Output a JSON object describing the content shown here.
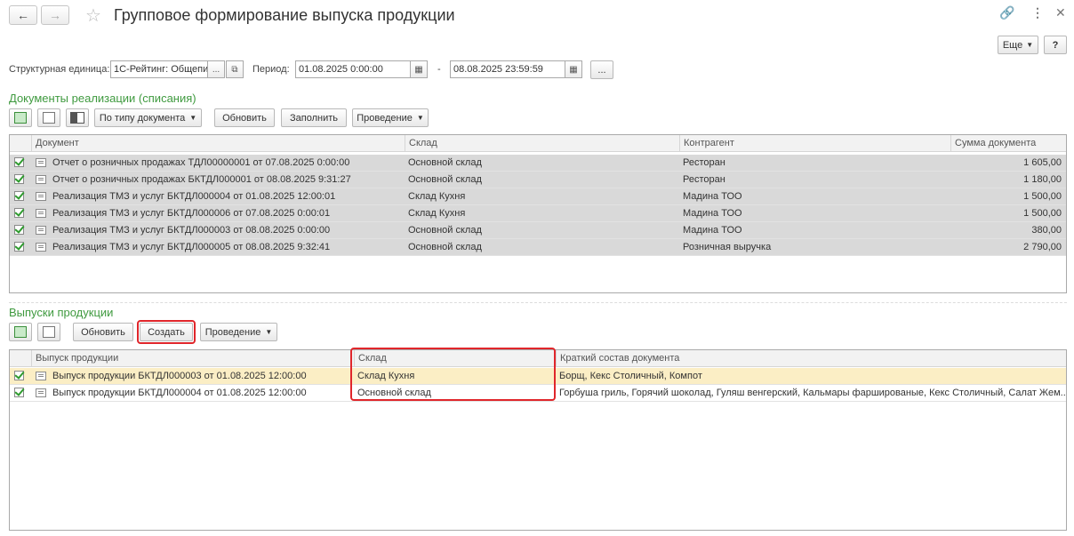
{
  "window": {
    "title": "Групповое формирование выпуска продукции",
    "more_label": "Еще",
    "help_label": "?"
  },
  "filters": {
    "unit_label": "Структурная единица:",
    "unit_value": "1С-Рейтинг: Общепи",
    "period_label": "Период:",
    "date_from": "01.08.2025  0:00:00",
    "date_to": "08.08.2025 23:59:59",
    "dash": "-",
    "dots": "..."
  },
  "sales": {
    "section_title": "Документы реализации (списания)",
    "toolbar": {
      "by_type_label": "По типу документа",
      "refresh_label": "Обновить",
      "fill_label": "Заполнить",
      "posting_label": "Проведение"
    },
    "columns": [
      "Документ",
      "Склад",
      "Контрагент",
      "Сумма документа"
    ],
    "rows": [
      {
        "doc": "Отчет о розничных продажах ТДЛ00000001 от 07.08.2025 0:00:00",
        "warehouse": "Основной склад",
        "partner": "Ресторан",
        "amount": "1 605,00"
      },
      {
        "doc": "Отчет о розничных продажах БКТДЛ000001 от 08.08.2025 9:31:27",
        "warehouse": "Основной склад",
        "partner": "Ресторан",
        "amount": "1 180,00"
      },
      {
        "doc": "Реализация ТМЗ и услуг БКТДЛ000004 от 01.08.2025 12:00:01",
        "warehouse": "Склад Кухня",
        "partner": "Мадина ТОО",
        "amount": "1 500,00"
      },
      {
        "doc": "Реализация ТМЗ и услуг БКТДЛ000006 от 07.08.2025 0:00:01",
        "warehouse": "Склад Кухня",
        "partner": "Мадина ТОО",
        "amount": "1 500,00"
      },
      {
        "doc": "Реализация ТМЗ и услуг БКТДЛ000003 от 08.08.2025 0:00:00",
        "warehouse": "Основной склад",
        "partner": "Мадина ТОО",
        "amount": "380,00"
      },
      {
        "doc": "Реализация ТМЗ и услуг БКТДЛ000005 от 08.08.2025 9:32:41",
        "warehouse": "Основной склад",
        "partner": "Розничная выручка",
        "amount": "2 790,00"
      }
    ]
  },
  "releases": {
    "section_title": "Выпуски продукции",
    "toolbar": {
      "refresh_label": "Обновить",
      "create_label": "Создать",
      "posting_label": "Проведение"
    },
    "columns": [
      "Выпуск продукции",
      "Склад",
      "Краткий состав документа"
    ],
    "rows": [
      {
        "doc": "Выпуск продукции БКТДЛ000003 от 01.08.2025 12:00:00",
        "warehouse": "Склад Кухня",
        "content": "Борщ, Кекс Столичный, Компот"
      },
      {
        "doc": "Выпуск продукции БКТДЛ000004 от 01.08.2025 12:00:00",
        "warehouse": "Основной склад",
        "content": "Горбуша гриль, Горячий шоколад, Гуляш венгерский, Кальмары фаршированые, Кекс Столичный, Салат Жем..."
      }
    ]
  },
  "colors": {
    "section_green": "#3f9a3f",
    "highlight_red": "#e0262b",
    "row_selected": "#d9d9d9",
    "row_current": "#fbeec5"
  }
}
